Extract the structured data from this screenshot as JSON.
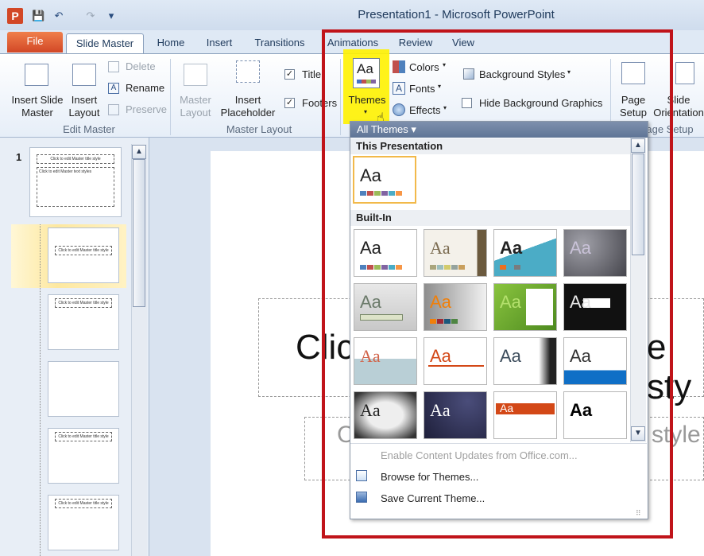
{
  "window": {
    "title": "Presentation1  -  Microsoft PowerPoint",
    "app_icon_letter": "P"
  },
  "tabs": [
    "File",
    "Slide Master",
    "Home",
    "Insert",
    "Transitions",
    "Animations",
    "Review",
    "View"
  ],
  "ribbon": {
    "edit_master": {
      "insert_slide_master": "Insert Slide\nMaster",
      "insert_layout": "Insert\nLayout",
      "delete": "Delete",
      "rename": "Rename",
      "preserve": "Preserve",
      "group_label": "Edit Master"
    },
    "master_layout": {
      "master_layout": "Master\nLayout",
      "insert_placeholder": "Insert\nPlaceholder",
      "title": "Title",
      "footers": "Footers",
      "group_label": "Master Layout"
    },
    "edit_theme": {
      "themes": "Themes",
      "colors": "Colors",
      "fonts": "Fonts",
      "effects": "Effects"
    },
    "background": {
      "background_styles": "Background Styles",
      "hide_background_graphics": "Hide Background Graphics"
    },
    "page_setup": {
      "page_setup": "Page\nSetup",
      "slide_orientation": "Slide\nOrientation",
      "group_label": "age Setup"
    }
  },
  "thumbnails": {
    "first_number": "1",
    "master_title": "Click to edit Master title style",
    "master_text": "Click to edit Master text styles"
  },
  "slide": {
    "title_placeholder": "Clic",
    "title_placeholder_right": "e sty",
    "subtitle_placeholder": "C",
    "subtitle_placeholder_right": "style"
  },
  "gallery": {
    "header": "All Themes",
    "section_this_presentation": "This Presentation",
    "section_builtin": "Built-In",
    "aa": "Aa",
    "menu": {
      "enable_updates": "Enable Content Updates from Office.com...",
      "browse": "Browse for Themes...",
      "save": "Save Current Theme..."
    }
  },
  "colors": {
    "accent_red": "#c0141a",
    "highlight": "#fff200",
    "file_tab": "#d24726"
  }
}
